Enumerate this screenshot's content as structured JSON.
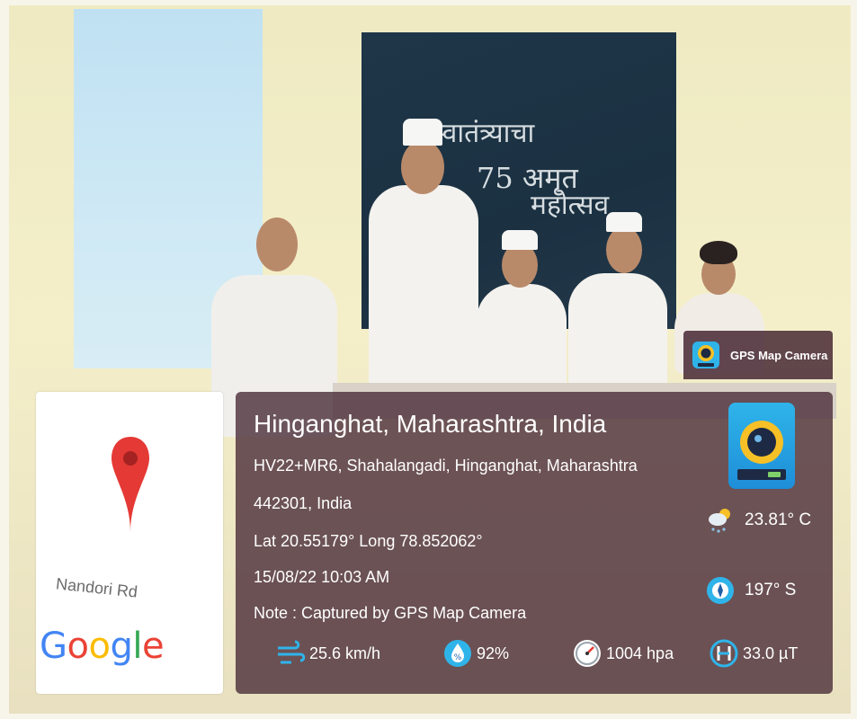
{
  "map": {
    "road_label": "Nandori Rd",
    "logo_letters": [
      "G",
      "o",
      "o",
      "g",
      "l",
      "e"
    ],
    "logo_colors": [
      "#4285F4",
      "#EA4335",
      "#FBBC05",
      "#4285F4",
      "#34A853",
      "#EA4335"
    ]
  },
  "brand": {
    "label": "GPS Map Camera"
  },
  "location": {
    "title": "Hinganghat, Maharashtra, India",
    "address_line1": "HV22+MR6, Shahalangadi, Hinganghat, Maharashtra",
    "address_line2": "442301, India",
    "coords": "Lat 20.55179° Long 78.852062°",
    "datetime": "15/08/22 10:03 AM",
    "note": "Note : Captured by GPS Map Camera"
  },
  "weather": {
    "temperature": "23.81° C",
    "direction": "197° S",
    "wind": "25.6 km/h",
    "humidity": "92%",
    "pressure": "1004 hpa",
    "magnetic": "33.0 µT"
  },
  "board": {
    "line1": "स्वातंत्र्याचा",
    "line2": "75 अमृत",
    "line3": "महोत्सव"
  },
  "colors": {
    "panel": "#46283a",
    "pin": "#E53935",
    "accent": "#2fb4ea"
  }
}
